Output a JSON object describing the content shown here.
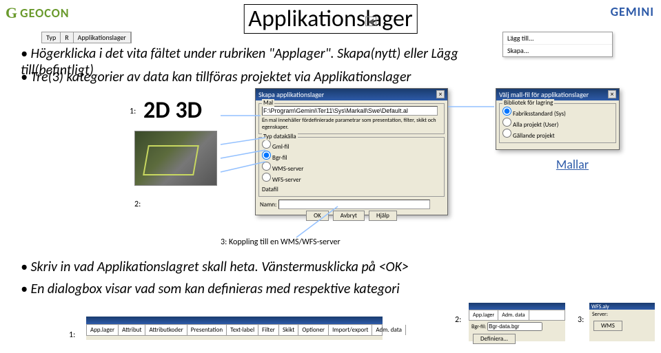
{
  "logos": {
    "left_mark": "G",
    "left_text": "GEOCON",
    "right": "GEMINI"
  },
  "title": "Applikationslager",
  "header_table": {
    "col1": "Typ",
    "col2": "R",
    "col3": "Applikationslager"
  },
  "menu": {
    "item1": "Lägg till...",
    "item2": "Skapa..."
  },
  "bullets": {
    "b1a": "Högerklicka i det vita fältet under rubriken \"Applager\".",
    "b1b": "Skapa(nytt) eller Lägg till(befintligt)",
    "b2": "Tre(3) kategorier av data kan tillföras projektet via Applikationslager",
    "b3a": "Skriv in vad Applikationslagret skall heta.",
    "b3b": "Vänstermusklicka på <OK>",
    "b4": "En dialogbox visar vad som kan definieras med respektive kategori"
  },
  "labels": {
    "one": "1:",
    "two": "2:",
    "three_caption": "3: Koppling till en WMS/WFS-server",
    "bottom1": "1:",
    "bottom2": "2:",
    "bottom3": "3:"
  },
  "big": "2D  3D",
  "mallar": "Mallar",
  "dlg1": {
    "title": "Skapa applikationslager",
    "mal_label": "Mal",
    "mal_path": "F:\\Program\\Gemini\\Ter11\\Sys\\Markall\\Swe\\Default.al",
    "mal_desc": "En mal innehåller fördefinierade parametrar som presentation, filter, skikt och egenskaper.",
    "typ_label": "Typ datakälla",
    "r1": "Gml-fil",
    "r2": "Bgr-fil",
    "r3": "WMS-server",
    "r4": "WFS-server",
    "datafil": "Datafil",
    "namn_label": "Namn:",
    "ok": "OK",
    "avbryt": "Avbryt",
    "hjalp": "Hjälp"
  },
  "dlg2": {
    "title": "Välj mall-fil för applikationslager",
    "group": "Bibliotek för lagring",
    "r1": "Fabriksstandard (Sys)",
    "r2": "Alla projekt (User)",
    "r3": "Gällande projekt"
  },
  "bottom_wide": {
    "tabs": [
      "App.lager",
      "Attribut",
      "Attributkoder",
      "Presentation",
      "Text-label",
      "Filter",
      "Skikt",
      "Optioner",
      "Import/export",
      "Adm. data"
    ]
  },
  "bottom_mid": {
    "tabs": [
      "App.lager",
      "Adm. data"
    ],
    "bgr_label": "Bgr-fil:",
    "bgr_val": "Bgr-data.bgr",
    "def_btn": "Definiera..."
  },
  "bottom_right": {
    "hdr": "WFS.aly",
    "lbl_server": "Server:",
    "btn_wms": "WMS"
  }
}
